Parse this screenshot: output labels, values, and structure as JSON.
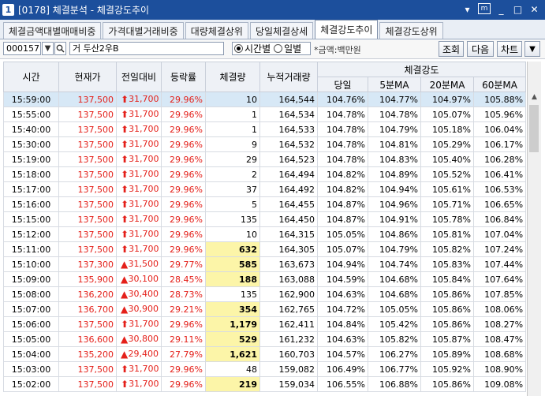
{
  "window": {
    "num": "1",
    "title": "[0178] 체결분석 - 체결강도추이",
    "btn_menu": "▾",
    "btn_m": "m",
    "btn_min": "_",
    "btn_max": "□",
    "btn_close": "✕"
  },
  "tabs": [
    "체결금액대별매매비중",
    "가격대별거래비중",
    "대량체결상위",
    "당일체결상세",
    "체결강도추이",
    "체결강도상위"
  ],
  "active_tab": 4,
  "toolbar": {
    "code": "000157",
    "search_icon": "search-icon",
    "name": "거 두산2우B",
    "radio_time": "시간별",
    "radio_day": "일별",
    "unit_note": "*금액:백만원",
    "btn_query": "조회",
    "btn_next": "다음",
    "btn_chart": "차트",
    "btn_more": "▼"
  },
  "headers": {
    "time": "시간",
    "price": "현재가",
    "change": "전일대비",
    "rate": "등락률",
    "volume": "체결량",
    "cum_volume": "누적거래량",
    "strength": "체결강도",
    "today": "당일",
    "ma5": "5분MA",
    "ma20": "20분MA",
    "ma60": "60분MA"
  },
  "rows": [
    {
      "time": "15:59:00",
      "price": "137,500",
      "arrow": "up",
      "change": "31,700",
      "rate": "29.96%",
      "vol": "10",
      "hl": false,
      "cum": "164,544",
      "today": "104.76%",
      "ma5": "104.77%",
      "ma20": "104.97%",
      "ma60": "105.88%"
    },
    {
      "time": "15:55:00",
      "price": "137,500",
      "arrow": "up",
      "change": "31,700",
      "rate": "29.96%",
      "vol": "1",
      "hl": false,
      "cum": "164,534",
      "today": "104.78%",
      "ma5": "104.78%",
      "ma20": "105.07%",
      "ma60": "105.96%"
    },
    {
      "time": "15:40:00",
      "price": "137,500",
      "arrow": "up",
      "change": "31,700",
      "rate": "29.96%",
      "vol": "1",
      "hl": false,
      "cum": "164,533",
      "today": "104.78%",
      "ma5": "104.79%",
      "ma20": "105.18%",
      "ma60": "106.04%"
    },
    {
      "time": "15:30:00",
      "price": "137,500",
      "arrow": "up",
      "change": "31,700",
      "rate": "29.96%",
      "vol": "9",
      "hl": false,
      "cum": "164,532",
      "today": "104.78%",
      "ma5": "104.81%",
      "ma20": "105.29%",
      "ma60": "106.17%"
    },
    {
      "time": "15:19:00",
      "price": "137,500",
      "arrow": "up",
      "change": "31,700",
      "rate": "29.96%",
      "vol": "29",
      "hl": false,
      "cum": "164,523",
      "today": "104.78%",
      "ma5": "104.83%",
      "ma20": "105.40%",
      "ma60": "106.28%"
    },
    {
      "time": "15:18:00",
      "price": "137,500",
      "arrow": "up",
      "change": "31,700",
      "rate": "29.96%",
      "vol": "2",
      "hl": false,
      "cum": "164,494",
      "today": "104.82%",
      "ma5": "104.89%",
      "ma20": "105.52%",
      "ma60": "106.41%"
    },
    {
      "time": "15:17:00",
      "price": "137,500",
      "arrow": "up",
      "change": "31,700",
      "rate": "29.96%",
      "vol": "37",
      "hl": false,
      "cum": "164,492",
      "today": "104.82%",
      "ma5": "104.94%",
      "ma20": "105.61%",
      "ma60": "106.53%"
    },
    {
      "time": "15:16:00",
      "price": "137,500",
      "arrow": "up",
      "change": "31,700",
      "rate": "29.96%",
      "vol": "5",
      "hl": false,
      "cum": "164,455",
      "today": "104.87%",
      "ma5": "104.96%",
      "ma20": "105.71%",
      "ma60": "106.65%"
    },
    {
      "time": "15:15:00",
      "price": "137,500",
      "arrow": "up",
      "change": "31,700",
      "rate": "29.96%",
      "vol": "135",
      "hl": false,
      "cum": "164,450",
      "today": "104.87%",
      "ma5": "104.91%",
      "ma20": "105.78%",
      "ma60": "106.84%"
    },
    {
      "time": "15:12:00",
      "price": "137,500",
      "arrow": "up",
      "change": "31,700",
      "rate": "29.96%",
      "vol": "10",
      "hl": false,
      "cum": "164,315",
      "today": "105.05%",
      "ma5": "104.86%",
      "ma20": "105.81%",
      "ma60": "107.04%"
    },
    {
      "time": "15:11:00",
      "price": "137,500",
      "arrow": "up",
      "change": "31,700",
      "rate": "29.96%",
      "vol": "632",
      "hl": true,
      "cum": "164,305",
      "today": "105.07%",
      "ma5": "104.79%",
      "ma20": "105.82%",
      "ma60": "107.24%"
    },
    {
      "time": "15:10:00",
      "price": "137,300",
      "arrow": "tri",
      "change": "31,500",
      "rate": "29.77%",
      "vol": "585",
      "hl": true,
      "cum": "163,673",
      "today": "104.94%",
      "ma5": "104.74%",
      "ma20": "105.83%",
      "ma60": "107.44%"
    },
    {
      "time": "15:09:00",
      "price": "135,900",
      "arrow": "tri",
      "change": "30,100",
      "rate": "28.45%",
      "vol": "188",
      "hl": true,
      "cum": "163,088",
      "today": "104.59%",
      "ma5": "104.68%",
      "ma20": "105.84%",
      "ma60": "107.64%"
    },
    {
      "time": "15:08:00",
      "price": "136,200",
      "arrow": "tri",
      "change": "30,400",
      "rate": "28.73%",
      "vol": "135",
      "hl": false,
      "cum": "162,900",
      "today": "104.63%",
      "ma5": "104.68%",
      "ma20": "105.86%",
      "ma60": "107.85%"
    },
    {
      "time": "15:07:00",
      "price": "136,700",
      "arrow": "tri",
      "change": "30,900",
      "rate": "29.21%",
      "vol": "354",
      "hl": true,
      "cum": "162,765",
      "today": "104.72%",
      "ma5": "105.05%",
      "ma20": "105.86%",
      "ma60": "108.06%"
    },
    {
      "time": "15:06:00",
      "price": "137,500",
      "arrow": "up",
      "change": "31,700",
      "rate": "29.96%",
      "vol": "1,179",
      "hl": true,
      "cum": "162,411",
      "today": "104.84%",
      "ma5": "105.42%",
      "ma20": "105.86%",
      "ma60": "108.27%"
    },
    {
      "time": "15:05:00",
      "price": "136,600",
      "arrow": "tri",
      "change": "30,800",
      "rate": "29.11%",
      "vol": "529",
      "hl": true,
      "cum": "161,232",
      "today": "104.63%",
      "ma5": "105.82%",
      "ma20": "105.87%",
      "ma60": "108.47%"
    },
    {
      "time": "15:04:00",
      "price": "135,200",
      "arrow": "tri",
      "change": "29,400",
      "rate": "27.79%",
      "vol": "1,621",
      "hl": true,
      "cum": "160,703",
      "today": "104.57%",
      "ma5": "106.27%",
      "ma20": "105.89%",
      "ma60": "108.68%"
    },
    {
      "time": "15:03:00",
      "price": "137,500",
      "arrow": "up",
      "change": "31,700",
      "rate": "29.96%",
      "vol": "48",
      "hl": false,
      "cum": "159,082",
      "today": "106.49%",
      "ma5": "106.77%",
      "ma20": "105.92%",
      "ma60": "108.90%"
    },
    {
      "time": "15:02:00",
      "price": "137,500",
      "arrow": "up",
      "change": "31,700",
      "rate": "29.96%",
      "vol": "219",
      "hl": true,
      "cum": "159,034",
      "today": "106.55%",
      "ma5": "106.88%",
      "ma20": "105.86%",
      "ma60": "109.08%"
    }
  ],
  "colors": {
    "up": "#e4201a",
    "highlight": "#fcf5a8",
    "selected_row": "#d7e8f6",
    "title_bar": "#1c4f9c"
  }
}
